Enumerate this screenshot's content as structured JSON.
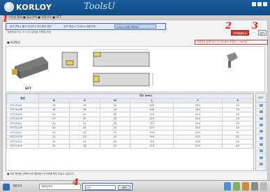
{
  "header": {
    "logo_text": "KORLOY",
    "brand_text": "ToolsU"
  },
  "breadcrumb": [
    "이전실 홈페",
    "■ 툴링선택",
    "■ 외경선삭",
    "■ GFT"
  ],
  "tabs": [
    "공구선택 ▸ 홀더 사이즈 ▸ 치수정보 확인",
    "공구 형상 ▸ 인서트 ▸ 재종선택",
    "[Step] 제품선택완료"
  ],
  "subnote": "제품형상/치수 보기 및 설정을 진행할 예정",
  "buttons": {
    "compare": "선택제품비교",
    "close": "닫기"
  },
  "section_title": "■ 외경형상",
  "links": "외경형상 설명자료 | 인서트/홀더 조합표 | 기술자료",
  "links_sub": "▸ 제품도 다운로드(DWG)",
  "product_label": "GFT",
  "annotations": [
    "1",
    "2",
    "3",
    "4"
  ],
  "table": {
    "group_header": "치수 (mm)",
    "side_header": "DXF",
    "columns": [
      "형번",
      "H",
      "h",
      "W",
      "L",
      "f",
      "S"
    ],
    "rows": [
      [
        "GFT1616L",
        "16",
        "16",
        "16",
        "100",
        "16.5",
        "20"
      ],
      [
        "GFT1616R",
        "16",
        "16",
        "16",
        "100",
        "16.5",
        "20"
      ],
      [
        "GFT1620L",
        "20",
        "20",
        "20",
        "125",
        "20.5",
        "25"
      ],
      [
        "GFT1620R",
        "20",
        "20",
        "20",
        "125",
        "20.5",
        "25"
      ],
      [
        "GFT2020L",
        "20",
        "20",
        "20",
        "125",
        "20.5",
        "25"
      ],
      [
        "GFT2020R",
        "20",
        "20",
        "20",
        "125",
        "20.5",
        "25"
      ],
      [
        "GFT2525L",
        "25",
        "25",
        "25",
        "150",
        "25.5",
        "32"
      ],
      [
        "GFT2525R",
        "25",
        "25",
        "25",
        "150",
        "25.5",
        "32"
      ],
      [
        "GFT3232L",
        "32",
        "32",
        "32",
        "170",
        "32.5",
        "40"
      ],
      [
        "GFT3232R",
        "32",
        "32",
        "32",
        "170",
        "32.5",
        "40"
      ]
    ]
  },
  "footnote": "■ 외경 형번을 선택하시면 해당하는 인서트를 확인 하실수 있습니다.",
  "bottom": {
    "label": "제품검색",
    "select_value": "제품명/형번",
    "search_value": "GFT",
    "search_button": "검색"
  },
  "colors": {
    "header": "#1c5f9e",
    "annotation": "#e2251c",
    "highlight_border": "#3e6db5",
    "compare_button": "#c83a32"
  }
}
